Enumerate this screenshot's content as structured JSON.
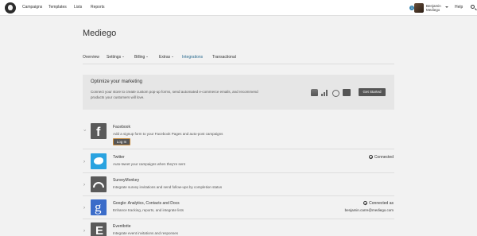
{
  "topnav": {
    "items": [
      "Campaigns",
      "Templates",
      "Lists",
      "Reports"
    ],
    "notification_count": "1",
    "user_name": "Benjamin",
    "user_org": "Mediego",
    "help": "Help"
  },
  "page": {
    "title": "Mediego"
  },
  "tabs": [
    "Overview",
    "Settings",
    "Billing",
    "Extras",
    "Integrations",
    "Transactional"
  ],
  "optimize": {
    "title": "Optimize your marketing",
    "desc": "Connect your store to create custom pop-up forms, send automated e-commerce emails, and recommend products your customers will love.",
    "button": "Get Started"
  },
  "integrations": [
    {
      "name": "Facebook",
      "desc": "Add a signup form to your Facebook Pages and auto-post campaigns",
      "button": "Log In",
      "icon": "facebook-icon"
    },
    {
      "name": "Twitter",
      "desc": "Auto-tweet your campaigns when they're sent",
      "status": "Connected",
      "icon": "twitter-icon"
    },
    {
      "name": "SurveyMonkey",
      "desc": "Integrate survey invitations and send follow-ups by completion status",
      "icon": "surveymonkey-icon"
    },
    {
      "name": "Google: Analytics, Contacts and Docs",
      "desc": "Enhance tracking, reports, and integrate lists",
      "status": "Connected as",
      "email": "benjamin.carre@mediego.com",
      "icon": "google-icon"
    },
    {
      "name": "Eventbrite",
      "desc": "Integrate event invitations and responses",
      "icon": "eventbrite-icon"
    }
  ],
  "colors": {
    "accent": "#2a6b8f",
    "twitter": "#2aa3e0",
    "google": "#3b6cc9",
    "button": "#555555"
  }
}
